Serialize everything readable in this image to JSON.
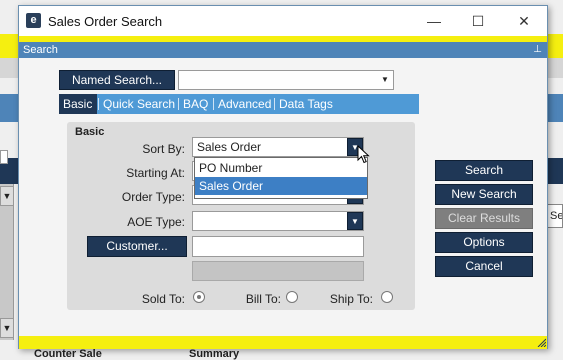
{
  "background": {
    "bottom_left_label": "Counter Sale",
    "bottom_right_label": "Summary",
    "right_button_label": "Se"
  },
  "window": {
    "title": "Sales Order Search",
    "minimize_symbol": "—",
    "maximize_symbol": "☐",
    "close_symbol": "✕",
    "logo_letter": "e"
  },
  "search_bar": {
    "label": "Search",
    "pin_symbol": "⊥"
  },
  "named_search": {
    "button_label": "Named Search...",
    "value": ""
  },
  "tabs": [
    {
      "label": "Basic",
      "active": true
    },
    {
      "label": "Quick Search",
      "active": false
    },
    {
      "label": "BAQ",
      "active": false
    },
    {
      "label": "Advanced",
      "active": false
    },
    {
      "label": "Data Tags",
      "active": false
    }
  ],
  "basic_panel": {
    "title": "Basic",
    "sort_by": {
      "label": "Sort By:",
      "value": "Sales Order"
    },
    "starting_at": {
      "label": "Starting At:",
      "value": ""
    },
    "order_type": {
      "label": "Order Type:",
      "value": ""
    },
    "aoe_type": {
      "label": "AOE Type:",
      "value": ""
    },
    "customer_button": "Customer...",
    "customer_value": "",
    "sort_options": [
      "PO Number",
      "Sales Order"
    ],
    "selected_option": "Sales Order",
    "radios": [
      {
        "label": "Sold To:",
        "checked": true
      },
      {
        "label": "Bill To:",
        "checked": false
      },
      {
        "label": "Ship To:",
        "checked": false
      }
    ]
  },
  "actions": {
    "search": "Search",
    "new_search": "New Search",
    "clear_results": "Clear Results",
    "options": "Options",
    "cancel": "Cancel"
  },
  "colors": {
    "accent_dark": "#1f3756",
    "tab_blue": "#4f9ad6",
    "title_blue": "#4e84b8",
    "highlight_yellow": "#f5ef10",
    "selection_blue": "#3d7fc5"
  }
}
